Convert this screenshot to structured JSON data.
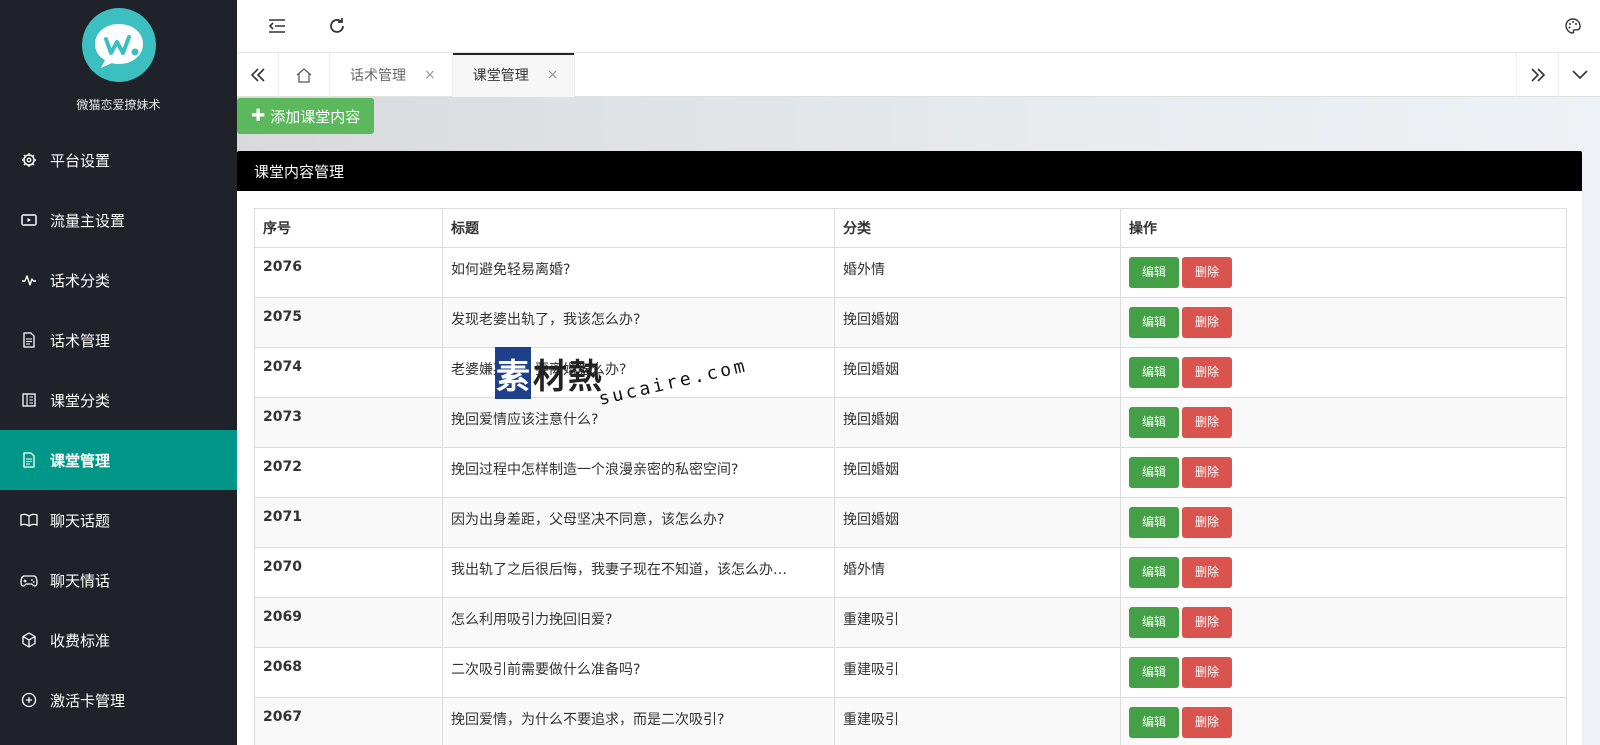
{
  "app": {
    "name": "微猫恋爱撩妹术"
  },
  "sidebar": {
    "items": [
      {
        "label": "平台设置",
        "icon": "gear-icon"
      },
      {
        "label": "流量主设置",
        "icon": "play-icon"
      },
      {
        "label": "话术分类",
        "icon": "pulse-icon"
      },
      {
        "label": "话术管理",
        "icon": "document-icon"
      },
      {
        "label": "课堂分类",
        "icon": "book-icon"
      },
      {
        "label": "课堂管理",
        "icon": "document-icon",
        "active": true
      },
      {
        "label": "聊天话题",
        "icon": "open-book-icon"
      },
      {
        "label": "聊天情话",
        "icon": "gamepad-icon"
      },
      {
        "label": "收费标准",
        "icon": "cube-icon"
      },
      {
        "label": "激活卡管理",
        "icon": "plus-circle-icon"
      }
    ]
  },
  "tabs": [
    {
      "label": "话术管理",
      "close": "×"
    },
    {
      "label": "课堂管理",
      "close": "×",
      "active": true
    }
  ],
  "toolbar": {
    "add_label": "添加课堂内容",
    "add_icon": "✚"
  },
  "panel": {
    "title": "课堂内容管理"
  },
  "table": {
    "headers": [
      "序号",
      "标题",
      "分类",
      "操作"
    ],
    "edit_label": "编辑",
    "delete_label": "删除",
    "rows": [
      {
        "id": "2076",
        "title": "如何避免轻易离婚?",
        "category": "婚外情"
      },
      {
        "id": "2075",
        "title": "发现老婆出轨了，我该怎么办?",
        "category": "挽回婚姻"
      },
      {
        "id": "2074",
        "title": "老婆嫌弃我，要离婚怎么办?",
        "category": "挽回婚姻"
      },
      {
        "id": "2073",
        "title": "挽回爱情应该注意什么?",
        "category": "挽回婚姻"
      },
      {
        "id": "2072",
        "title": "挽回过程中怎样制造一个浪漫亲密的私密空间?",
        "category": "挽回婚姻"
      },
      {
        "id": "2071",
        "title": "因为出身差距，父母坚决不同意，该怎么办?",
        "category": "挽回婚姻"
      },
      {
        "id": "2070",
        "title": "我出轨了之后很后悔，我妻子现在不知道，该怎么办…",
        "category": "婚外情"
      },
      {
        "id": "2069",
        "title": "怎么利用吸引力挽回旧爱?",
        "category": "重建吸引"
      },
      {
        "id": "2068",
        "title": "二次吸引前需要做什么准备吗?",
        "category": "重建吸引"
      },
      {
        "id": "2067",
        "title": "挽回爱情，为什么不要追求，而是二次吸引?",
        "category": "重建吸引"
      }
    ]
  },
  "watermark": {
    "box": "素",
    "cn": "材熱",
    "en": "sucaire.com"
  },
  "colors": {
    "sidebar_bg": "#20222a",
    "active": "#009688",
    "add_btn": "#5cb85c",
    "edit": "#43a047",
    "delete": "#d9534f"
  }
}
